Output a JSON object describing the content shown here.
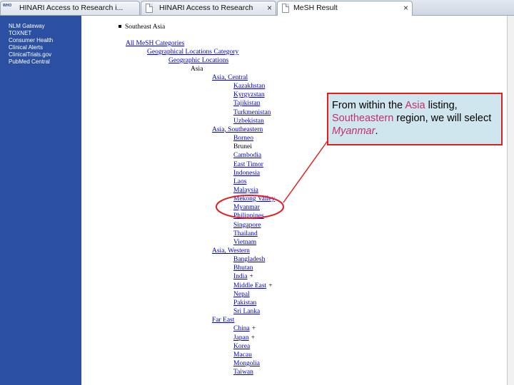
{
  "tabs": [
    {
      "label": "HINARI Access to Research i...",
      "icon": "who-logo-icon",
      "logo_text": "WHO",
      "active": false
    },
    {
      "label": "HINARI Access to Research",
      "icon": "document-icon",
      "active": false
    },
    {
      "label": "MeSH Result",
      "icon": "document-icon",
      "active": true
    }
  ],
  "sidebar": {
    "items": [
      "NLM Gateway",
      "TOXNET",
      "Consumer Health",
      "Clinical Alerts",
      "ClinicalTrials.gov",
      "PubMed Central"
    ]
  },
  "tree": {
    "heading": "Southeast Asia",
    "all_categories": "All MeSH Categories",
    "geo_category": "Geographical Locations Category",
    "geo_locations": "Geographic Locations",
    "asia": "Asia",
    "groups": [
      {
        "label": "Asia, Central",
        "items": [
          {
            "label": "Kazakhstan"
          },
          {
            "label": "Kyrgyzstan"
          },
          {
            "label": "Tajikistan"
          },
          {
            "label": "Turkmenistan"
          },
          {
            "label": "Uzbekistan"
          }
        ]
      },
      {
        "label": "Asia, Southeastern",
        "items": [
          {
            "label": "Borneo"
          },
          {
            "label": "Brunei",
            "link": false
          },
          {
            "label": "Cambodia"
          },
          {
            "label": "East Timor"
          },
          {
            "label": "Indonesia"
          },
          {
            "label": "Laos"
          },
          {
            "label": "Malaysia"
          },
          {
            "label": "Mekong Valley"
          },
          {
            "label": "Myanmar"
          },
          {
            "label": "Philippines"
          },
          {
            "label": "Singapore"
          },
          {
            "label": "Thailand"
          },
          {
            "label": "Vietnam"
          }
        ]
      },
      {
        "label": "Asia, Western",
        "items": [
          {
            "label": "Bangladesh"
          },
          {
            "label": "Bhutan"
          },
          {
            "label": "India",
            "suffix": "+"
          },
          {
            "label": "Middle East",
            "suffix": "+"
          },
          {
            "label": "Nepal"
          },
          {
            "label": "Pakistan"
          },
          {
            "label": "Sri Lanka"
          }
        ]
      },
      {
        "label": "Far East",
        "items": [
          {
            "label": "China",
            "suffix": "+"
          },
          {
            "label": "Japan",
            "suffix": "+"
          },
          {
            "label": "Korea"
          },
          {
            "label": "Macau"
          },
          {
            "label": "Mongolia"
          },
          {
            "label": "Taiwan"
          }
        ]
      }
    ]
  },
  "callout": {
    "part1": "From within the ",
    "asia": "Asia",
    "part2": " listing, ",
    "region": "Southeastern",
    "part3": " region, we will select ",
    "country": "Myanmar",
    "part4": "."
  },
  "colors": {
    "sidebar_bg": "#2b4fa1",
    "link": "#0000cc",
    "callout_bg": "#cfe6ee",
    "callout_border": "#e02020",
    "highlight_text": "#c0306a",
    "annotation_red": "#e02020"
  }
}
